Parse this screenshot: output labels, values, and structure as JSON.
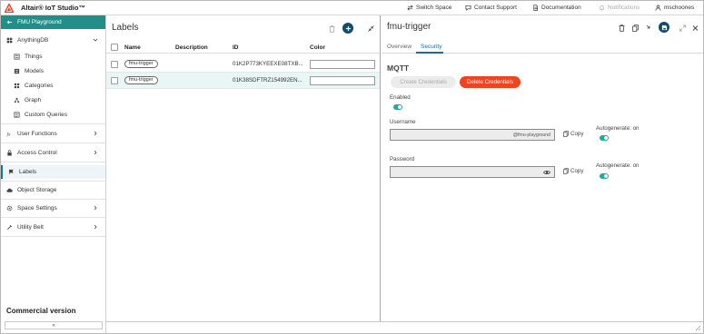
{
  "header": {
    "app_title": "Altair® IoT Studio™",
    "switch_space": "Switch Space",
    "contact_support": "Contact Support",
    "documentation": "Documentation",
    "notifications": "Notifications",
    "user": "mschoones"
  },
  "sidebar": {
    "space": "FMU Playground",
    "items": [
      {
        "label": "AnythingDB",
        "icon": "database-icon"
      },
      {
        "label": "Things",
        "icon": "things-icon"
      },
      {
        "label": "Models",
        "icon": "models-icon"
      },
      {
        "label": "Categories",
        "icon": "categories-icon"
      },
      {
        "label": "Graph",
        "icon": "graph-icon"
      },
      {
        "label": "Custom Queries",
        "icon": "query-icon"
      },
      {
        "label": "User Functions",
        "icon": "function-icon"
      },
      {
        "label": "Access Control",
        "icon": "lock-icon"
      },
      {
        "label": "Labels",
        "icon": "label-icon"
      },
      {
        "label": "Object Storage",
        "icon": "cloud-icon"
      },
      {
        "label": "Space Settings",
        "icon": "settings-icon"
      },
      {
        "label": "Utility Belt",
        "icon": "tools-icon"
      }
    ],
    "commercial": "Commercial version",
    "collapse": "«"
  },
  "labels_panel": {
    "title": "Labels",
    "columns": {
      "name": "Name",
      "description": "Description",
      "id": "ID",
      "color": "Color"
    },
    "rows": [
      {
        "name": "fmu-trigger",
        "description": "",
        "id": "01K2P773KYEEXE08TXB..."
      },
      {
        "name": "fmu-trigger",
        "description": "",
        "id": "01K38SDFTRZ154992EN..."
      }
    ]
  },
  "detail": {
    "title": "fmu-trigger",
    "tabs": [
      "Overview",
      "Security"
    ],
    "active_tab": "Security",
    "section": "MQTT",
    "create_credentials": "Create Credentials",
    "delete_credentials": "Delete Credentials",
    "enabled_label": "Enabled",
    "enabled": true,
    "username_label": "Username",
    "username_suffix": "@fmu-playground",
    "password_label": "Password",
    "copy": "Copy",
    "autogenerate": "Autogenerate: on"
  },
  "colors": {
    "accent_teal": "#1f8f88",
    "primary_navy": "#124a70",
    "danger": "#f0441f",
    "toggle_on": "#22a89c"
  }
}
